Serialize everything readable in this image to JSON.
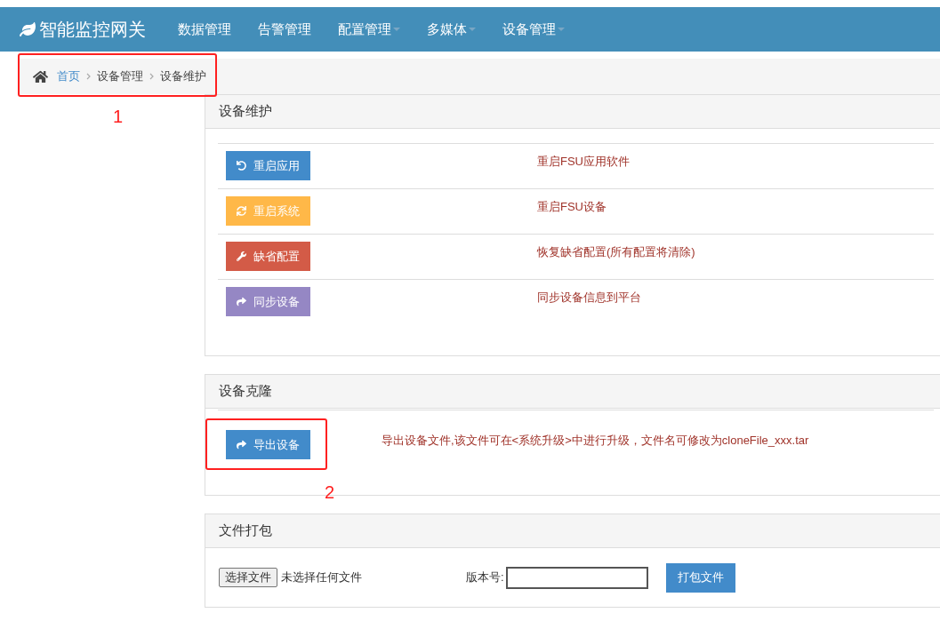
{
  "brand": {
    "title": "智能监控网关"
  },
  "nav": [
    {
      "label": "数据管理",
      "has_menu": false
    },
    {
      "label": "告警管理",
      "has_menu": false
    },
    {
      "label": "配置管理",
      "has_menu": true
    },
    {
      "label": "多媒体",
      "has_menu": true
    },
    {
      "label": "设备管理",
      "has_menu": true
    }
  ],
  "breadcrumb": [
    {
      "label": "首页",
      "link": true
    },
    {
      "label": "设备管理",
      "link": false
    },
    {
      "label": "设备维护",
      "link": false
    }
  ],
  "maintenance": {
    "title": "设备维护",
    "rows": [
      {
        "kind": "primary",
        "button": "重启应用",
        "description": "重启FSU应用软件"
      },
      {
        "kind": "warning",
        "button": "重启系统",
        "description": "重启FSU设备"
      },
      {
        "kind": "danger",
        "button": "缺省配置",
        "description": "恢复缺省配置(所有配置将清除)"
      },
      {
        "kind": "purple",
        "button": "同步设备",
        "description": "同步设备信息到平台"
      }
    ]
  },
  "clone": {
    "title": "设备克隆",
    "button": "导出设备",
    "description": "导出设备文件,该文件可在<系统升级>中进行升级，文件名可修改为cloneFile_xxx.tar"
  },
  "pack": {
    "title": "文件打包",
    "file_button": "选择文件",
    "file_status": "未选择任何文件",
    "version_label": "版本号:",
    "button": "打包文件"
  },
  "annotations": [
    "1",
    "2"
  ]
}
